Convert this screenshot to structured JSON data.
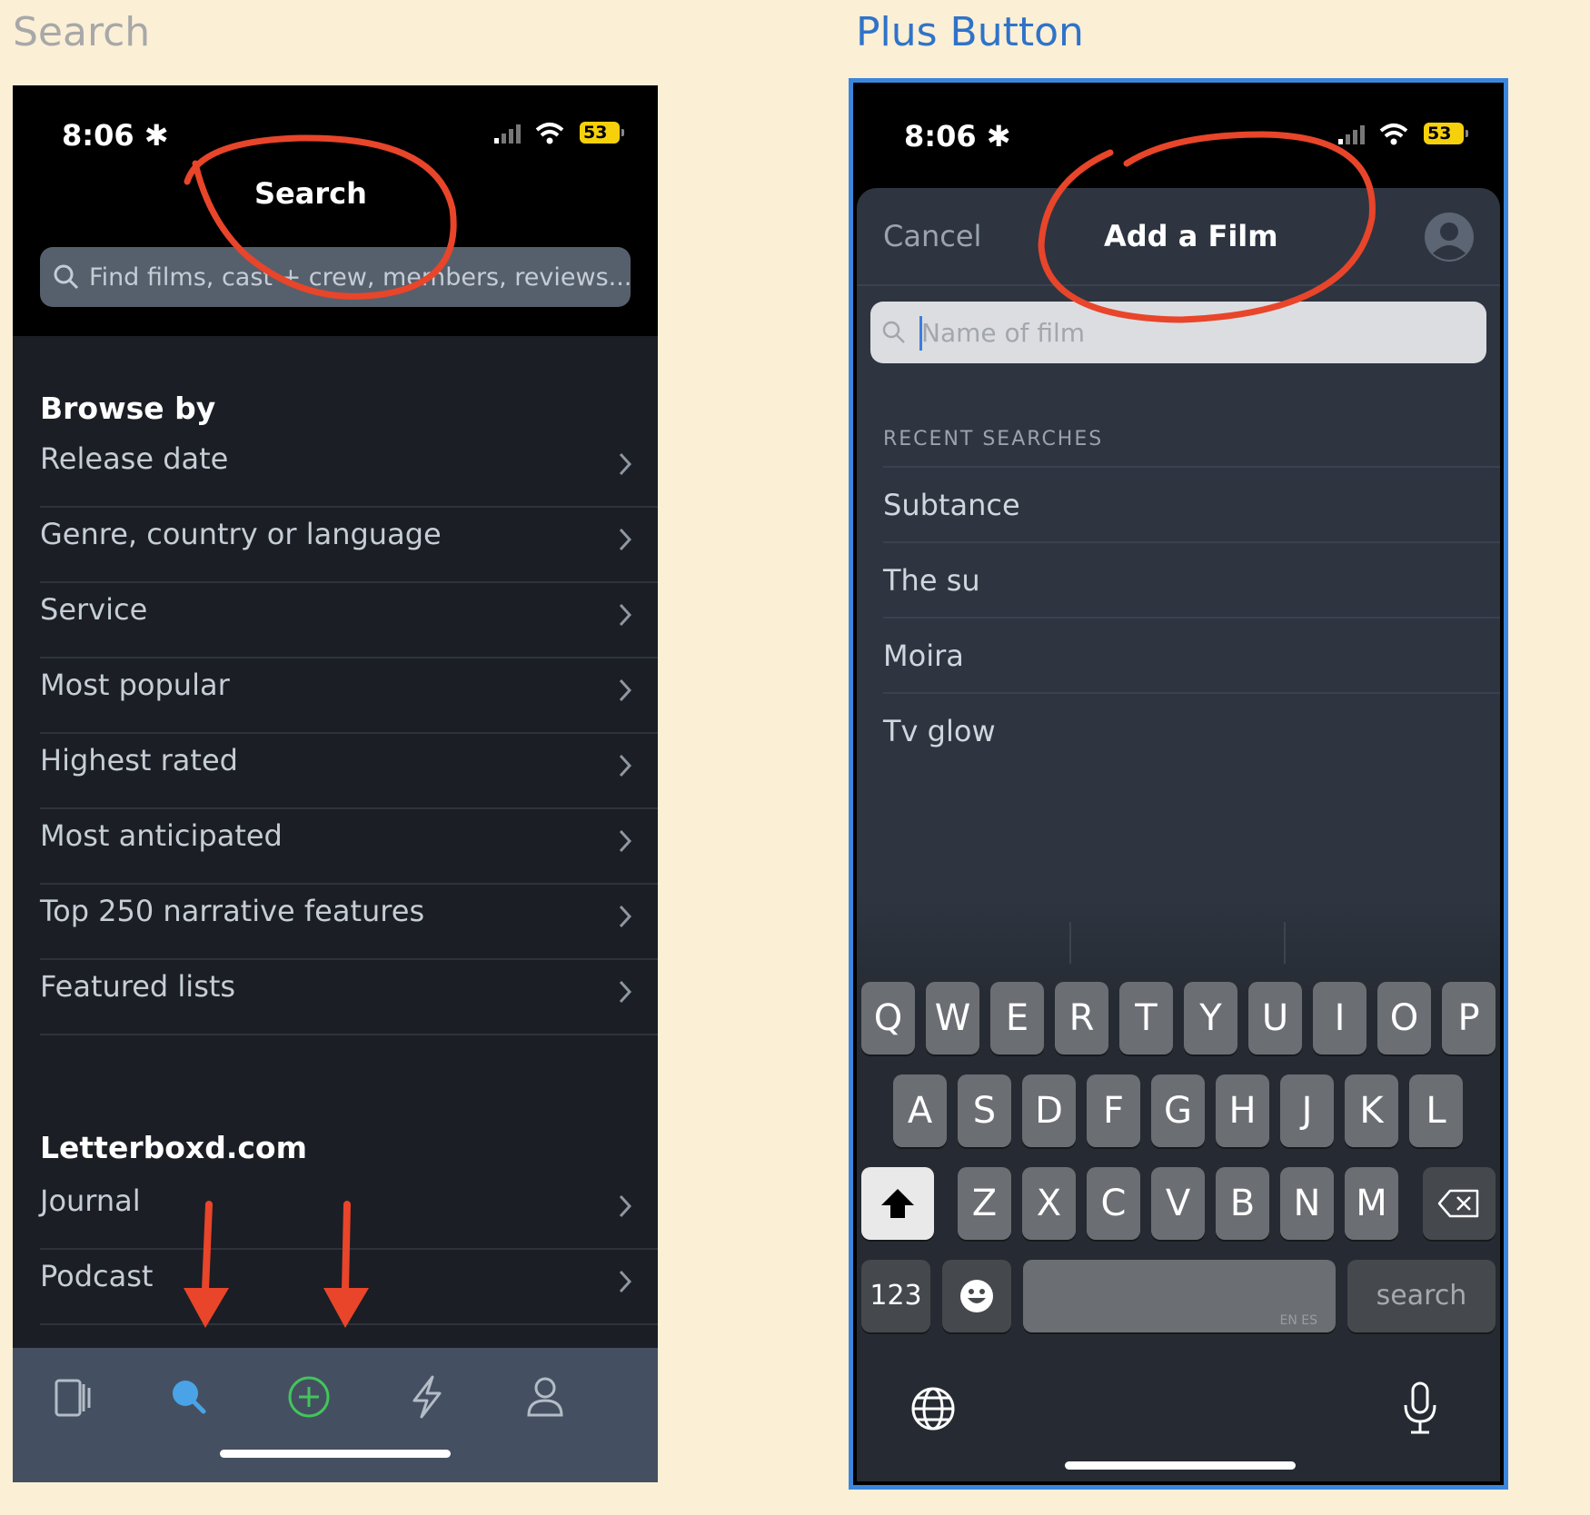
{
  "labels": {
    "left": "Search",
    "right": "Plus Button"
  },
  "status": {
    "time": "8:06",
    "battery": "53"
  },
  "search_screen": {
    "title": "Search",
    "search_placeholder": "Find films, cast + crew, members, reviews...",
    "browse_heading": "Browse by",
    "browse_items": [
      "Release date",
      "Genre, country or language",
      "Service",
      "Most popular",
      "Highest rated",
      "Most anticipated",
      "Top 250 narrative features",
      "Featured lists"
    ],
    "site_heading": "Letterboxd.com",
    "site_items": [
      "Journal",
      "Podcast"
    ],
    "tabs": [
      "films-icon",
      "search-icon",
      "add-icon",
      "activity-icon",
      "profile-icon"
    ],
    "active_tab": "search-icon",
    "accent_search": "#4aa3e6",
    "accent_add": "#43c55a"
  },
  "add_film_screen": {
    "cancel_label": "Cancel",
    "title": "Add a Film",
    "search_placeholder": "Name of film",
    "recent_heading": "RECENT SEARCHES",
    "recent_items": [
      "Subtance",
      "The su",
      "Moira",
      "Tv glow"
    ]
  },
  "keyboard": {
    "row1": [
      "Q",
      "W",
      "E",
      "R",
      "T",
      "Y",
      "U",
      "I",
      "O",
      "P"
    ],
    "row2": [
      "A",
      "S",
      "D",
      "F",
      "G",
      "H",
      "J",
      "K",
      "L"
    ],
    "row3": [
      "Z",
      "X",
      "C",
      "V",
      "B",
      "N",
      "M"
    ],
    "numbers_key": "123",
    "space_sub": "EN ES",
    "return_key": "search"
  },
  "annotation_color": "#e8452a"
}
